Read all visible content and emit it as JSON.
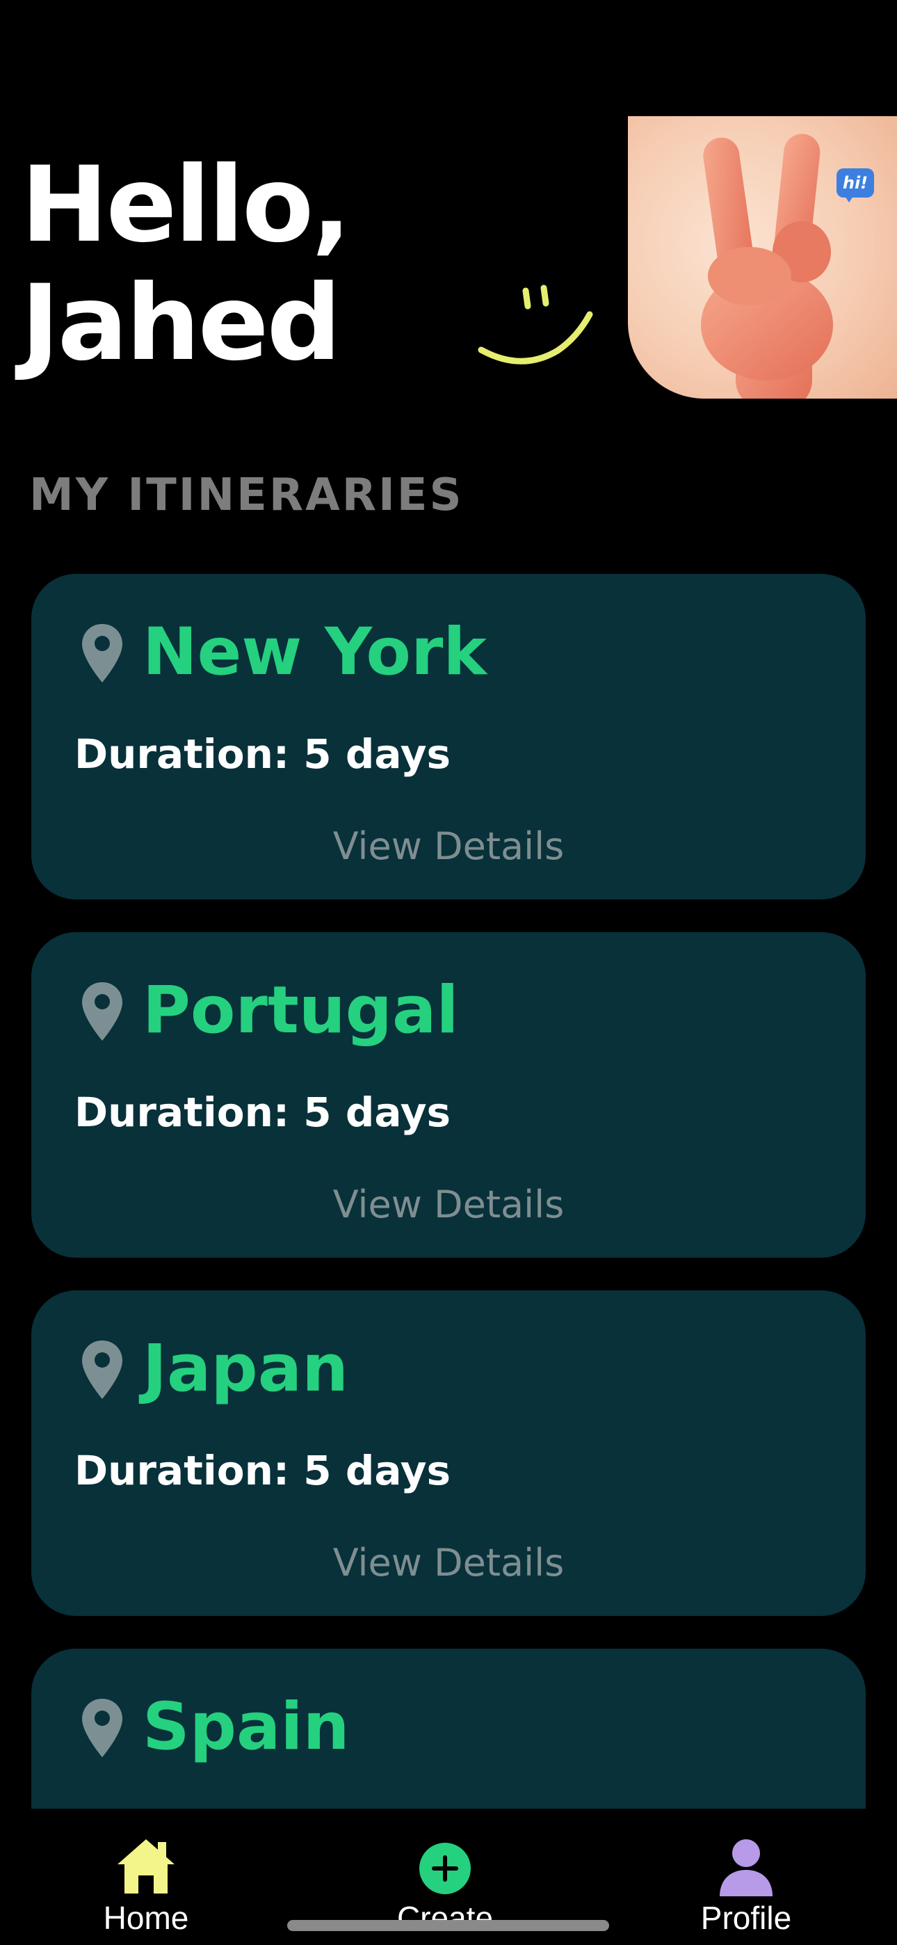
{
  "greeting": {
    "line1": "Hello,",
    "line2": "Jahed"
  },
  "hero": {
    "badge_text": "hi!"
  },
  "section": {
    "title": "MY ITINERARIES"
  },
  "itineraries": [
    {
      "city": "New York",
      "duration": "Duration: 5 days",
      "action": "View Details"
    },
    {
      "city": "Portugal",
      "duration": "Duration: 5 days",
      "action": "View Details"
    },
    {
      "city": "Japan",
      "duration": "Duration: 5 days",
      "action": "View Details"
    },
    {
      "city": "Spain"
    }
  ],
  "tabs": [
    {
      "label": "Home",
      "icon": "home-icon",
      "color": "#f3f58a"
    },
    {
      "label": "Create",
      "icon": "plus-circle-icon",
      "color": "#25d07f"
    },
    {
      "label": "Profile",
      "icon": "person-icon",
      "color": "#b79ae8"
    }
  ],
  "colors": {
    "background": "#000000",
    "card": "#08313a",
    "accent_green": "#25d07f",
    "smiley_yellow": "#e6ee6f",
    "muted_text": "#7f8e91"
  }
}
